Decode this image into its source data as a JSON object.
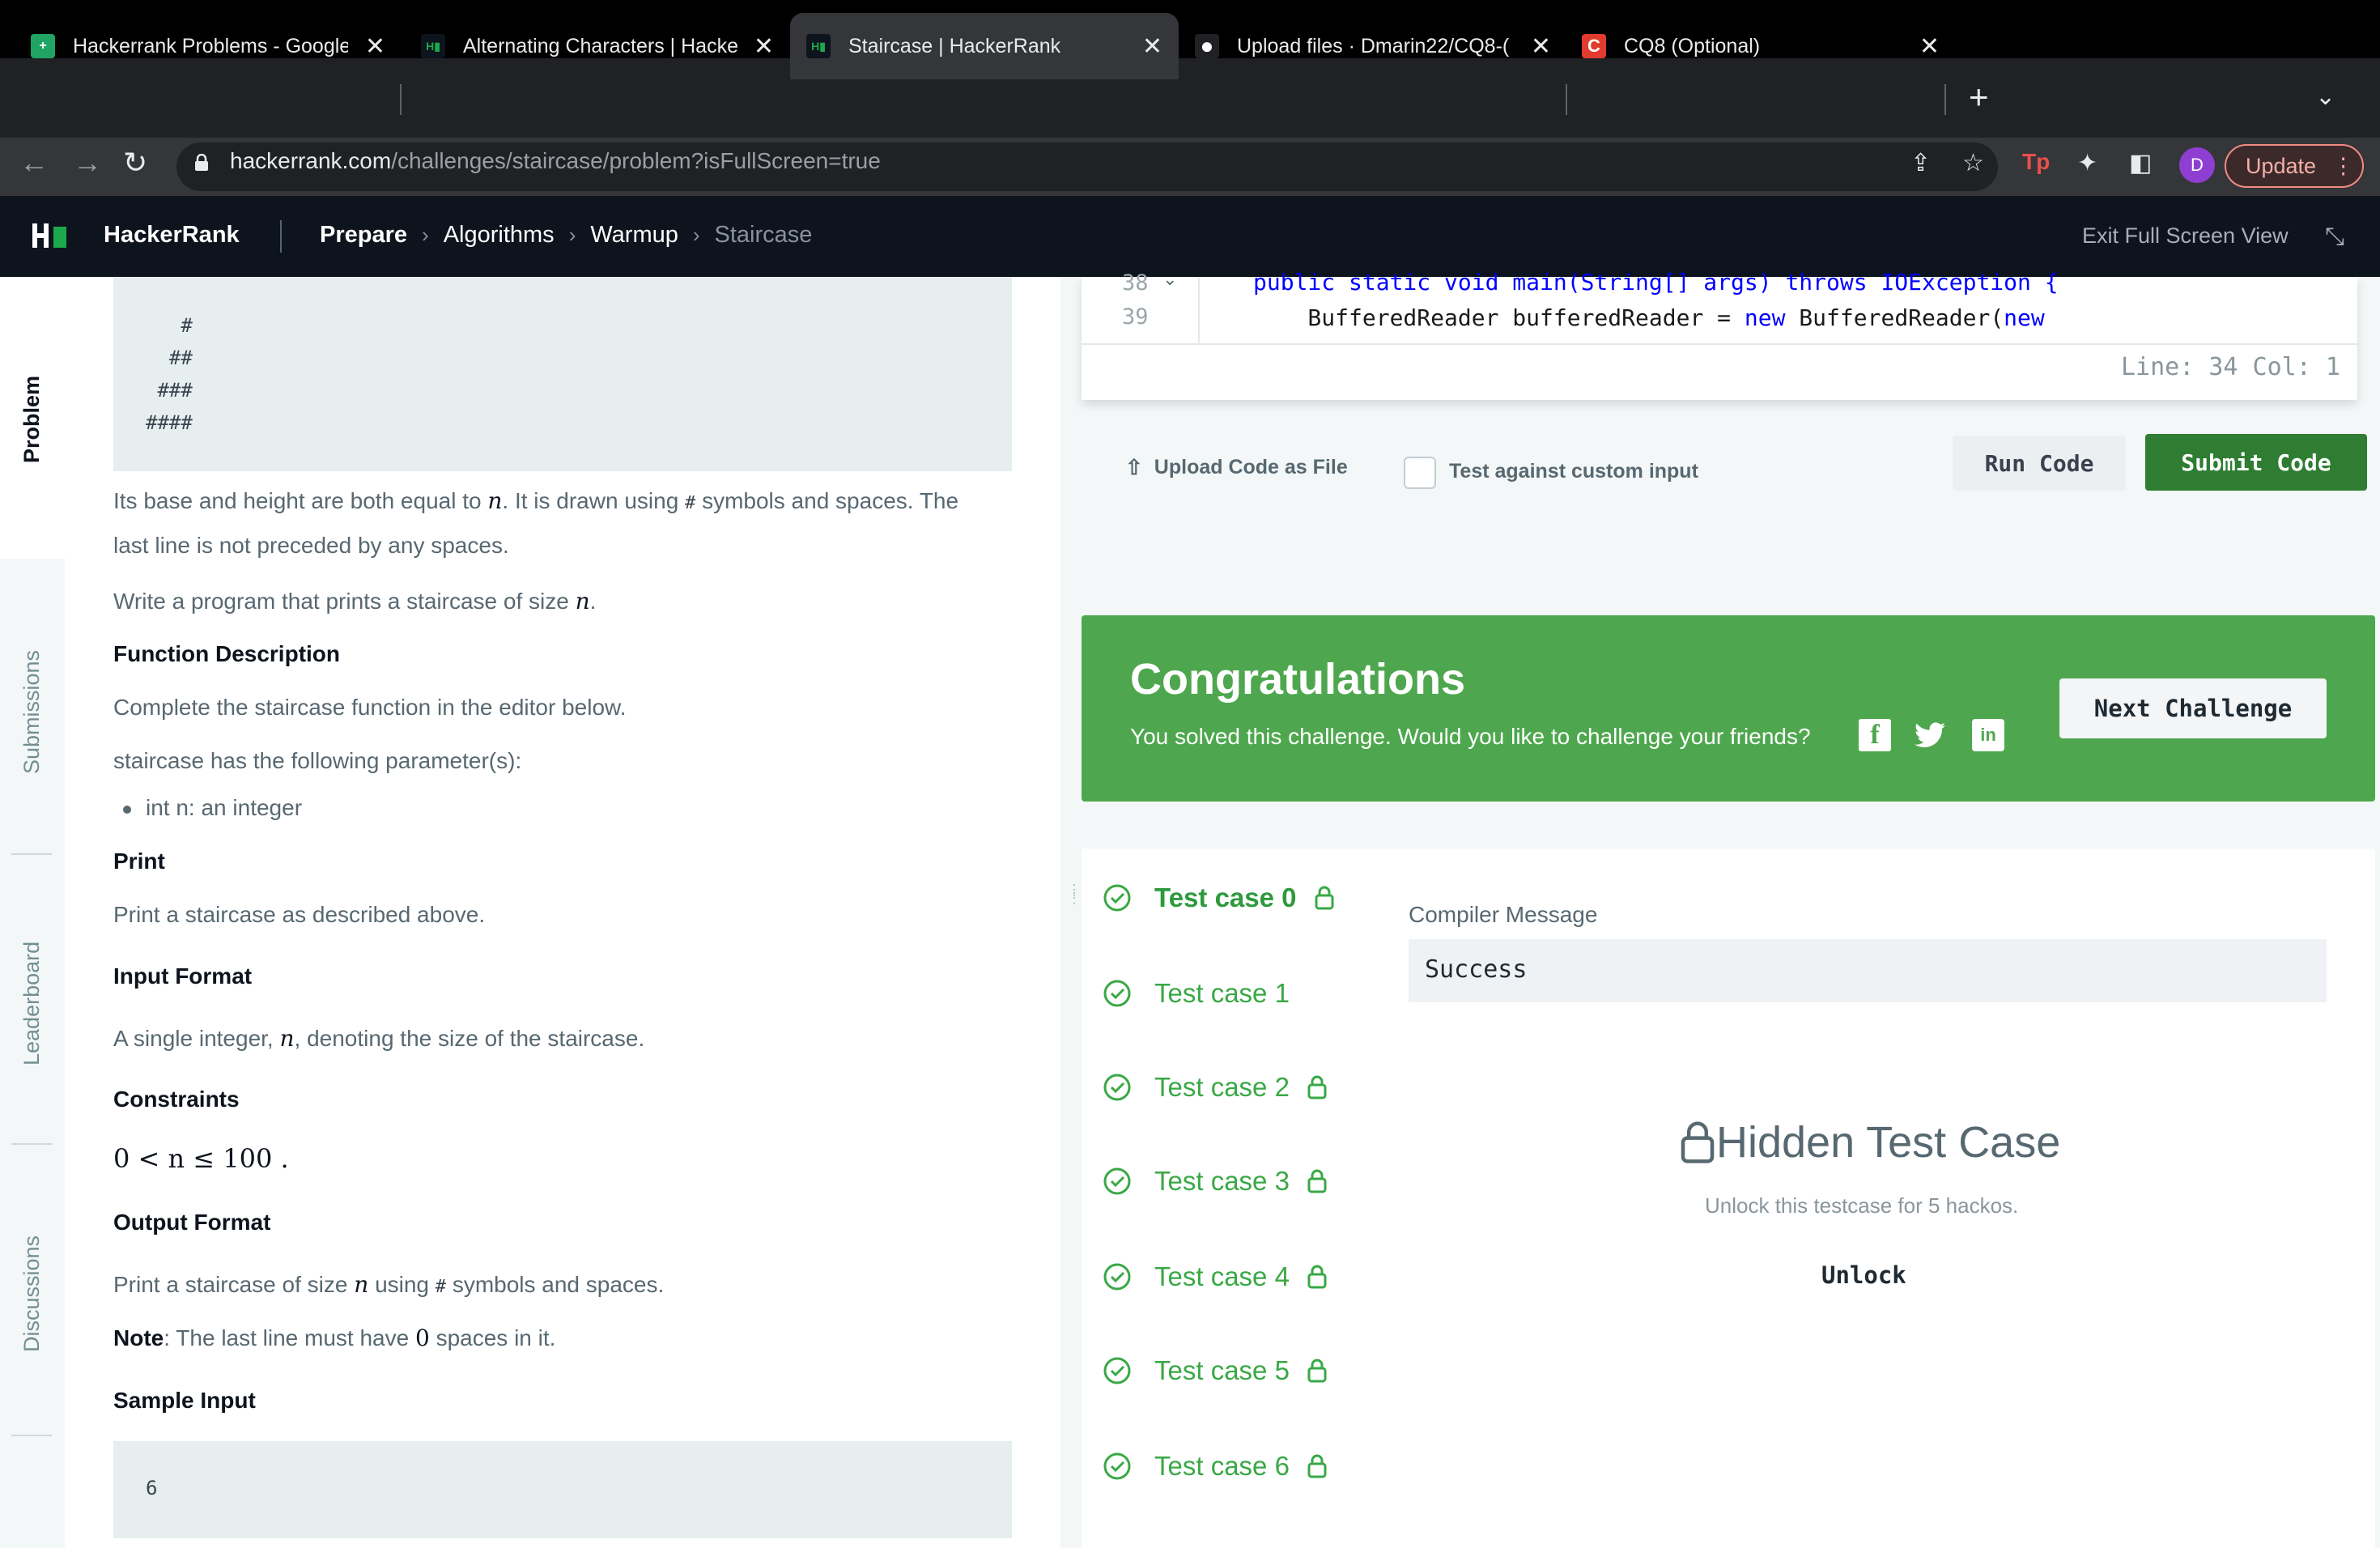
{
  "browser": {
    "tabs": [
      {
        "title": "Hackerrank Problems - Google",
        "icon": "google-sheets-icon",
        "color": "#1fa463"
      },
      {
        "title": "Alternating Characters | Hacke",
        "icon": "hackerrank-icon",
        "color": "#1ba94c"
      },
      {
        "title": "Staircase | HackerRank",
        "icon": "hackerrank-icon",
        "color": "#1ba94c"
      },
      {
        "title": "Upload files · Dmarin22/CQ8-(",
        "icon": "github-icon",
        "color": "#ffffff"
      },
      {
        "title": "CQ8 (Optional)",
        "icon": "canvas-icon",
        "color": "#e13b2d"
      }
    ],
    "close_glyph": "✕",
    "url_host": "hackerrank.com",
    "url_path": "/challenges/staircase/problem?isFullScreen=true",
    "profile_initial": "D",
    "update_label": "Update"
  },
  "header": {
    "brand": "HackerRank",
    "breadcrumb": [
      "Prepare",
      "Algorithms",
      "Warmup",
      "Staircase"
    ],
    "exit_label": "Exit Full Screen View"
  },
  "leftnav": [
    "Problem",
    "Submissions",
    "Leaderboard",
    "Discussions"
  ],
  "problem": {
    "staircase_example": "   #\n  ##\n ###\n####",
    "p1_a": "Its base and height are both equal to",
    "p1_var": "n",
    "p1_b": ". It is drawn using",
    "p1_hash": "#",
    "p1_c": "symbols and spaces. The",
    "p1_line2": "last line is not preceded by any spaces.",
    "p2_a": "Write a program that prints a staircase of size",
    "p2_var": "n",
    "p2_end": ".",
    "func_heading": "Function Description",
    "func_text": "Complete the staircase function in the editor below.",
    "params_text": "staircase has the following parameter(s):",
    "param_item": "int n: an integer",
    "print_heading": "Print",
    "print_text": "Print a staircase as described above.",
    "input_heading": "Input Format",
    "input_a": "A single integer,",
    "input_var": "n",
    "input_b": ", denoting the size of the staircase.",
    "constraints_heading": "Constraints",
    "constraint": "0 < n ≤ 100 .",
    "output_heading": "Output Format",
    "output_a": "Print a staircase of size",
    "output_var": "n",
    "output_b": "using",
    "output_hash": "#",
    "output_c": "symbols and spaces.",
    "note_bold": "Note",
    "note_a": ": The last line must have",
    "note_zero": "0",
    "note_b": "spaces in it.",
    "sample_heading": "Sample Input",
    "sample_value": "6"
  },
  "editor": {
    "line38_num": "38",
    "line38_code": "public static void main(String[] args) throws IOException {",
    "line39_num": "39",
    "line39_pre": "    BufferedReader bufferedReader = ",
    "line39_kw1": "new",
    "line39_mid": " BufferedReader(",
    "line39_kw2": "new",
    "status": "Line: 34 Col: 1"
  },
  "actions": {
    "upload_label": "Upload Code as File",
    "custom_input_label": "Test against custom input",
    "run_label": "Run Code",
    "submit_label": "Submit Code"
  },
  "congrats": {
    "title": "Congratulations",
    "subtitle": "You solved this challenge. Would you like to challenge your friends?",
    "next_label": "Next Challenge",
    "social": [
      "facebook-icon",
      "twitter-icon",
      "linkedin-icon"
    ],
    "color": "#4ea74e"
  },
  "tests": {
    "cases": [
      "Test case 0",
      "Test case 1",
      "Test case 2",
      "Test case 3",
      "Test case 4",
      "Test case 5",
      "Test case 6"
    ],
    "compiler_label": "Compiler Message",
    "compiler_message": "Success",
    "hidden_title": "Hidden Test Case",
    "hidden_sub": "Unlock this testcase for 5 hackos.",
    "unlock_label": "Unlock",
    "pass_color": "#39a845"
  }
}
